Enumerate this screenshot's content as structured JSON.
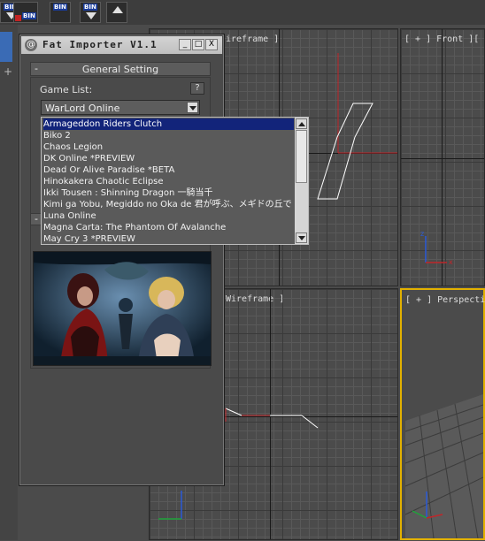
{
  "window": {
    "title": "Fat Importer V1.1",
    "minimize": "_",
    "maximize": "□",
    "close": "X"
  },
  "toolbar": {
    "buttons": [
      {
        "label": "BIN"
      },
      {
        "label": "BIN"
      },
      {
        "label": "BIN"
      },
      {
        "label": "BIN"
      }
    ]
  },
  "viewports": {
    "top_left_label": "ireframe ]",
    "front_label": "[ + ] Front ][",
    "left_label": "Wireframe ]",
    "perspective_label": "[ + ] Perspective"
  },
  "general_setting": {
    "collapse": "-",
    "title": "General Setting",
    "game_list_label": "Game List:",
    "help": "?",
    "selected_game": "WarLord Online"
  },
  "second_rollout": {
    "collapse": "-"
  },
  "dropdown": {
    "items": [
      "Armageddon Riders Clutch",
      "Biko 2",
      "Chaos Legion",
      "DK Online *PREVIEW",
      "Dead Or Alive Paradise *BETA",
      "Hinokakera Chaotic Eclipse",
      "Ikki Tousen : Shinning Dragon 一騎当千",
      "Kimi ga Yobu, Megiddo no Oka de 君が呼ぶ、メギドの丘で",
      "Luna Online",
      "Magna Carta: The Phantom Of Avalanche",
      "May Cry 3 *PREVIEW"
    ],
    "highlighted_index": 0
  },
  "colors": {
    "viewport_bg": "#4b4b4b",
    "active_border": "#e2b100",
    "selection": "#12247a",
    "axis_red": "#c0262a",
    "axis_green": "#1fa33a",
    "axis_blue": "#2b5bd8"
  }
}
